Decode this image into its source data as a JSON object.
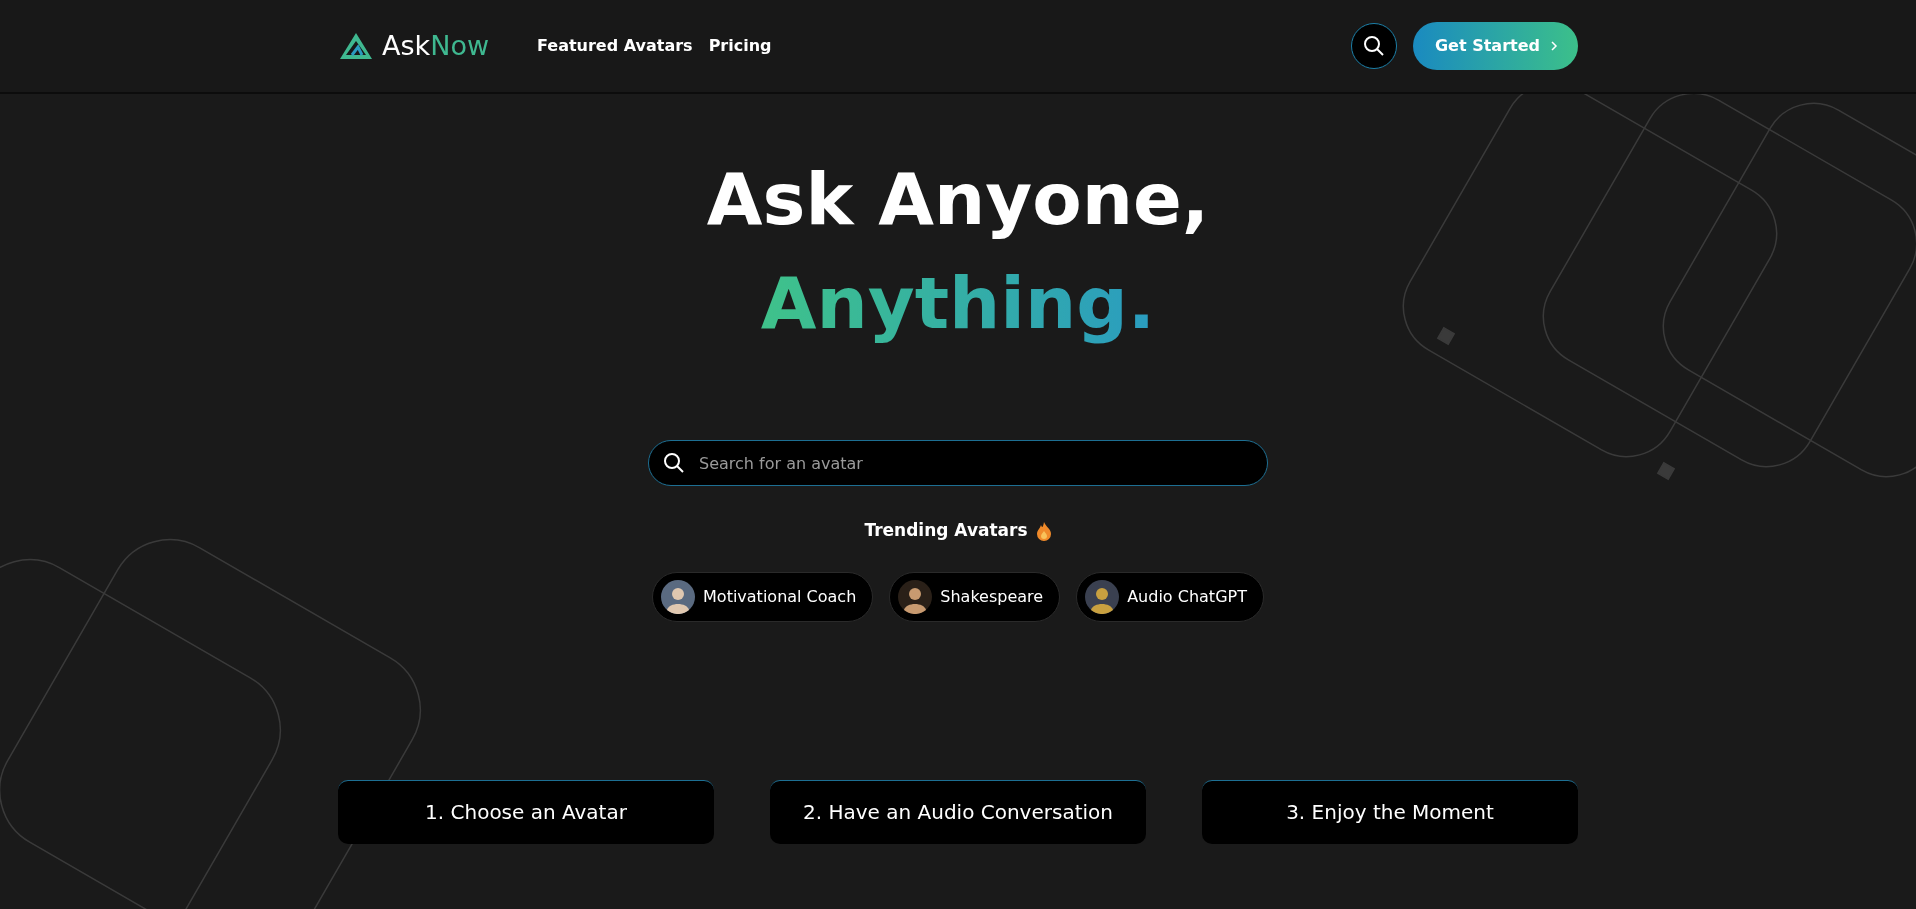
{
  "header": {
    "logo": {
      "part_1": "Ask",
      "part_2": "Now"
    },
    "nav": [
      {
        "label": "Featured Avatars"
      },
      {
        "label": "Pricing"
      }
    ],
    "cta": "Get Started"
  },
  "hero": {
    "title_line_1": "Ask Anyone,",
    "title_line_2": "Anything."
  },
  "search": {
    "placeholder": "Search for an avatar"
  },
  "trending": {
    "title": "Trending Avatars",
    "avatars": [
      {
        "label": "Motivational Coach"
      },
      {
        "label": "Shakespeare"
      },
      {
        "label": "Audio ChatGPT"
      }
    ]
  },
  "steps": [
    {
      "label": "1. Choose an Avatar"
    },
    {
      "label": "2. Have an Audio Conversation"
    },
    {
      "label": "3. Enjoy the Moment"
    }
  ]
}
